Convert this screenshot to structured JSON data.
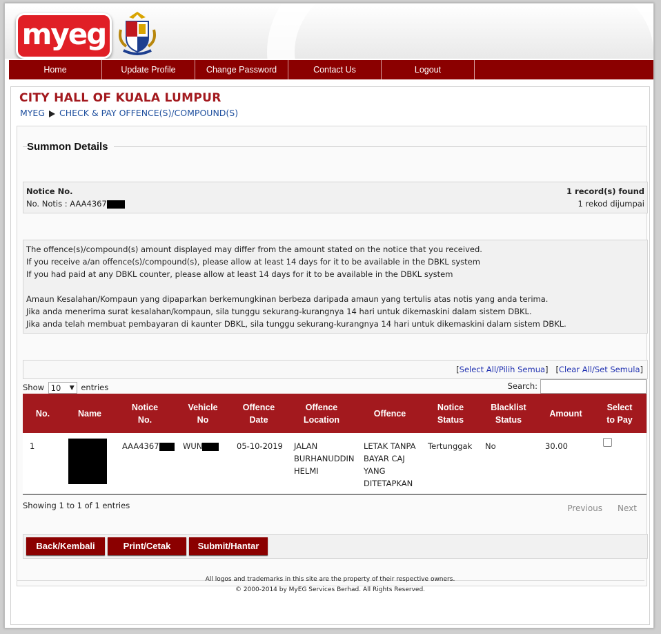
{
  "header": {
    "logo_text": "myeg",
    "crest_name": "dbkl-crest"
  },
  "nav": {
    "items": [
      {
        "label": "Home"
      },
      {
        "label": "Update Profile"
      },
      {
        "label": "Change Password"
      },
      {
        "label": "Contact Us"
      },
      {
        "label": "Logout"
      }
    ]
  },
  "page": {
    "title": "CITY HALL OF KUALA LUMPUR",
    "breadcrumb": {
      "home": "MYEG",
      "current": "CHECK & PAY OFFENCE(S)/COMPOUND(S)"
    }
  },
  "summon": {
    "section_title": "Summon Details",
    "notice_label": "Notice No.",
    "notice_value": "No. Notis : AAA4367",
    "records_en": "1 record(s) found",
    "records_ms": "1 rekod dijumpai"
  },
  "info": {
    "lines": [
      "The offence(s)/compound(s) amount displayed may differ from the amount stated on the notice that you received.",
      "If you receive a/an offence(s)/compound(s), please allow at least 14 days for it to be available in the DBKL system",
      "If you had paid at any DBKL counter, please allow at least 14 days for it to be available in the DBKL system",
      "Amaun Kesalahan/Kompaun yang dipaparkan berkemungkinan berbeza daripada amaun yang tertulis atas notis yang anda terima.",
      "Jika anda menerima surat kesalahan/kompaun, sila tunggu sekurang-kurangnya 14 hari untuk dikemaskini dalam sistem DBKL.",
      "Jika anda telah membuat pembayaran di kaunter DBKL, sila tunggu sekurang-kurangnya 14 hari untuk dikemaskini dalam sistem DBKL."
    ]
  },
  "selection": {
    "select_all": "Select All/Pilih Semua",
    "clear_all": "Clear All/Set Semula"
  },
  "table": {
    "show_label": "Show",
    "entries_value": "10",
    "entries_label": "entries",
    "search_label": "Search:",
    "columns": [
      "No.",
      "Name",
      "Notice\nNo.",
      "Vehicle\nNo",
      "Offence\nDate",
      "Offence\nLocation",
      "Offence",
      "Notice\nStatus",
      "Blacklist\nStatus",
      "Amount",
      "Select\nto Pay"
    ],
    "rows": [
      {
        "no": "1",
        "notice_no": "AAA4367",
        "vehicle_no": "WUN",
        "offence_date": "05-10-2019",
        "offence_location": "JALAN BURHANUDDIN HELMI",
        "offence": "LETAK TANPA BAYAR CAJ YANG DITETAPKAN",
        "notice_status": "Tertunggak",
        "blacklist_status": "No",
        "amount": "30.00"
      }
    ],
    "info": "Showing 1 to 1 of 1 entries",
    "previous": "Previous",
    "next": "Next"
  },
  "buttons": {
    "back": "Back/Kembali",
    "print": "Print/Cetak",
    "submit": "Submit/Hantar"
  },
  "footer": {
    "line1": "All logos and trademarks in this site are the property of their respective owners.",
    "line2": "© 2000-2014 by MyEG Services Berhad. All Rights Reserved."
  },
  "colors": {
    "brand_red": "#8b0000",
    "table_head": "#a3191e",
    "link_blue": "#1e4f9e"
  }
}
